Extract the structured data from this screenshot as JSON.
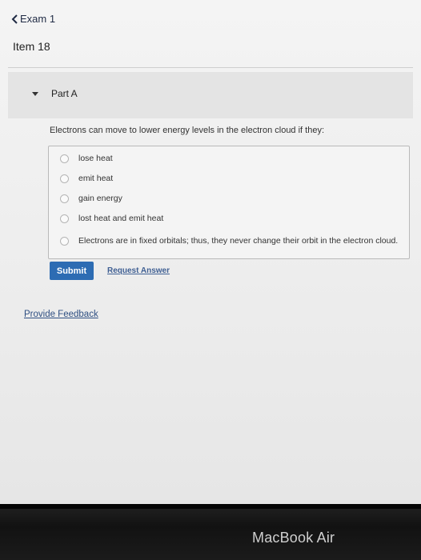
{
  "nav": {
    "back_label": "Exam 1"
  },
  "item": {
    "title": "Item 18"
  },
  "part": {
    "label": "Part A"
  },
  "question": {
    "text": "Electrons can move to lower energy levels in the electron cloud if they:"
  },
  "options": [
    "lose heat",
    "emit heat",
    "gain energy",
    "lost heat and emit heat",
    "Electrons are in fixed orbitals; thus, they never change their orbit in the electron cloud."
  ],
  "actions": {
    "submit_label": "Submit",
    "request_answer_label": "Request Answer"
  },
  "feedback": {
    "label": "Provide Feedback"
  },
  "device": {
    "brand": "MacBook Air"
  },
  "colors": {
    "submit_bg": "#2d6cb3",
    "link": "#3f5f93"
  }
}
